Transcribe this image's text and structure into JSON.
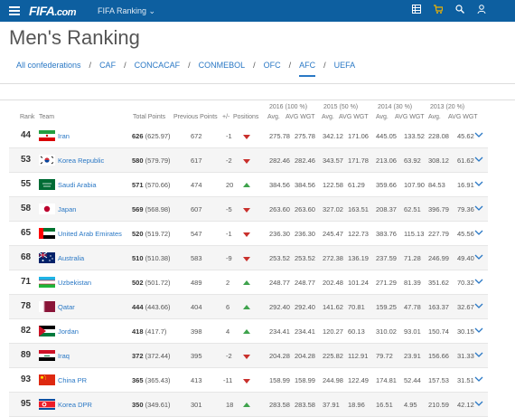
{
  "header": {
    "logo_main": "FIFA",
    "logo_suffix": ".com",
    "section": "FIFA Ranking ⌄",
    "icons": [
      "menu-icon",
      "grid-icon",
      "cart-icon",
      "search-icon",
      "user-icon"
    ]
  },
  "page_title": "Men's Ranking",
  "confederations": [
    "All confederations",
    "CAF",
    "CONCACAF",
    "CONMEBOL",
    "OFC",
    "AFC",
    "UEFA"
  ],
  "active_confederation": "AFC",
  "table": {
    "group_headers": [
      "2016 (100 %)",
      "2015 (50 %)",
      "2014 (30 %)",
      "2013 (20 %)"
    ],
    "columns": [
      "Rank",
      "Team",
      "Total Points",
      "Previous Points",
      "+/-",
      "Positions",
      "Avg.",
      "AVG WGT",
      "Avg.",
      "AVG WGT",
      "Avg.",
      "AVG WGT",
      "Avg.",
      "AVG WGT"
    ],
    "rows": [
      {
        "rank": "44",
        "team": "Iran",
        "pts": "626",
        "ptsx": "(625.97)",
        "prev": "672",
        "chg": "-1",
        "dir": "down",
        "v": [
          "275.78",
          "275.78",
          "342.12",
          "171.06",
          "445.05",
          "133.52",
          "228.08",
          "45.62"
        ],
        "flag": "ir"
      },
      {
        "rank": "53",
        "team": "Korea Republic",
        "pts": "580",
        "ptsx": "(579.79)",
        "prev": "617",
        "chg": "-2",
        "dir": "down",
        "v": [
          "282.46",
          "282.46",
          "343.57",
          "171.78",
          "213.06",
          "63.92",
          "308.12",
          "61.62"
        ],
        "flag": "kr"
      },
      {
        "rank": "55",
        "team": "Saudi Arabia",
        "pts": "571",
        "ptsx": "(570.66)",
        "prev": "474",
        "chg": "20",
        "dir": "up",
        "v": [
          "384.56",
          "384.56",
          "122.58",
          "61.29",
          "359.66",
          "107.90",
          "84.53",
          "16.91"
        ],
        "flag": "sa"
      },
      {
        "rank": "58",
        "team": "Japan",
        "pts": "569",
        "ptsx": "(568.98)",
        "prev": "607",
        "chg": "-5",
        "dir": "down",
        "v": [
          "263.60",
          "263.60",
          "327.02",
          "163.51",
          "208.37",
          "62.51",
          "396.79",
          "79.36"
        ],
        "flag": "jp"
      },
      {
        "rank": "65",
        "team": "United Arab Emirates",
        "pts": "520",
        "ptsx": "(519.72)",
        "prev": "547",
        "chg": "-1",
        "dir": "down",
        "v": [
          "236.30",
          "236.30",
          "245.47",
          "122.73",
          "383.76",
          "115.13",
          "227.79",
          "45.56"
        ],
        "flag": "ae"
      },
      {
        "rank": "68",
        "team": "Australia",
        "pts": "510",
        "ptsx": "(510.38)",
        "prev": "583",
        "chg": "-9",
        "dir": "down",
        "v": [
          "253.52",
          "253.52",
          "272.38",
          "136.19",
          "237.59",
          "71.28",
          "246.99",
          "49.40"
        ],
        "flag": "au"
      },
      {
        "rank": "71",
        "team": "Uzbekistan",
        "pts": "502",
        "ptsx": "(501.72)",
        "prev": "489",
        "chg": "2",
        "dir": "up",
        "v": [
          "248.77",
          "248.77",
          "202.48",
          "101.24",
          "271.29",
          "81.39",
          "351.62",
          "70.32"
        ],
        "flag": "uz"
      },
      {
        "rank": "78",
        "team": "Qatar",
        "pts": "444",
        "ptsx": "(443.66)",
        "prev": "404",
        "chg": "6",
        "dir": "up",
        "v": [
          "292.40",
          "292.40",
          "141.62",
          "70.81",
          "159.25",
          "47.78",
          "163.37",
          "32.67"
        ],
        "flag": "qa"
      },
      {
        "rank": "82",
        "team": "Jordan",
        "pts": "418",
        "ptsx": "(417.7)",
        "prev": "398",
        "chg": "4",
        "dir": "up",
        "v": [
          "234.41",
          "234.41",
          "120.27",
          "60.13",
          "310.02",
          "93.01",
          "150.74",
          "30.15"
        ],
        "flag": "jo"
      },
      {
        "rank": "89",
        "team": "Iraq",
        "pts": "372",
        "ptsx": "(372.44)",
        "prev": "395",
        "chg": "-2",
        "dir": "down",
        "v": [
          "204.28",
          "204.28",
          "225.82",
          "112.91",
          "79.72",
          "23.91",
          "156.66",
          "31.33"
        ],
        "flag": "iq"
      },
      {
        "rank": "93",
        "team": "China PR",
        "pts": "365",
        "ptsx": "(365.43)",
        "prev": "413",
        "chg": "-11",
        "dir": "down",
        "v": [
          "158.99",
          "158.99",
          "244.98",
          "122.49",
          "174.81",
          "52.44",
          "157.53",
          "31.51"
        ],
        "flag": "cn"
      },
      {
        "rank": "95",
        "team": "Korea DPR",
        "pts": "350",
        "ptsx": "(349.61)",
        "prev": "301",
        "chg": "18",
        "dir": "up",
        "v": [
          "283.58",
          "283.58",
          "37.91",
          "18.96",
          "16.51",
          "4.95",
          "210.59",
          "42.12"
        ],
        "flag": "kp"
      }
    ]
  }
}
